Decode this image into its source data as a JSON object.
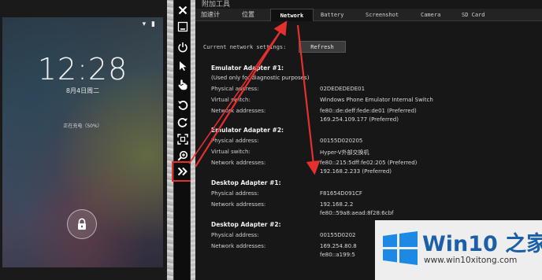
{
  "phone": {
    "status_icons": "▾ ▮",
    "time": "12:28",
    "date": "8月4日周二",
    "charging_text": "正在充电（50%）"
  },
  "tools": {
    "window_title": "附加工具",
    "tabs": [
      {
        "label": "加速计",
        "active": false
      },
      {
        "label": "位置",
        "active": false
      },
      {
        "label": "Network",
        "active": true
      },
      {
        "label": "Battery",
        "active": false
      },
      {
        "label": "Screenshot",
        "active": false
      },
      {
        "label": "Camera",
        "active": false
      },
      {
        "label": "SD Card",
        "active": false
      }
    ],
    "network_label": "Current network settings:",
    "refresh_label": "Refresh",
    "adapters": [
      {
        "title": "Emulator Adapter #1:",
        "note": "(Used only for diagnostic purposes)",
        "physical_label": "Physical address:",
        "physical_value": "02DEDEDEDE01",
        "switch_label": "Virtual switch:",
        "switch_value": "Windows Phone Emulator Internal Switch",
        "network_label": "Network addresses:",
        "network_values": [
          "fe80::de:deff:fede:de01 (Preferred)",
          "169.254.109.177 (Preferred)"
        ]
      },
      {
        "title": "Emulator Adapter #2:",
        "physical_label": "Physical address:",
        "physical_value": "00155D020205",
        "switch_label": "Virtual switch:",
        "switch_value": "Hyper-V外部交换机",
        "network_label": "Network addresses:",
        "network_values": [
          "fe80::215:5dff:fe02:205 (Preferred)",
          "192.168.2.233 (Preferred)"
        ]
      },
      {
        "title": "Desktop Adapter #1:",
        "physical_label": "Physical address:",
        "physical_value": "F81654D091CF",
        "network_label": "Network addresses:",
        "network_values": [
          "192.168.2.2",
          "fe80::59a8:aead:8f28:6cbf"
        ]
      },
      {
        "title": "Desktop Adapter #2:",
        "physical_label": "Physical address:",
        "physical_value": "00155D0202",
        "network_label": "Network addresses:",
        "network_values": [
          "169.254.80.8",
          "fe80::a199:5"
        ]
      }
    ]
  },
  "toolbar": {
    "buttons": [
      "close-icon",
      "minimize-icon",
      "power-icon",
      "pointer-icon",
      "touch-icon",
      "rotate-left-icon",
      "rotate-right-icon",
      "fit-screen-icon",
      "zoom-icon",
      "more-tools-icon"
    ]
  },
  "watermark": {
    "brand": "Win10 之家",
    "url": "www.win10xitong.com"
  },
  "colors": {
    "annotation_red": "#e53030",
    "watermark_blue": "#1b5fa8",
    "windows_blue": "#1e88e5"
  }
}
